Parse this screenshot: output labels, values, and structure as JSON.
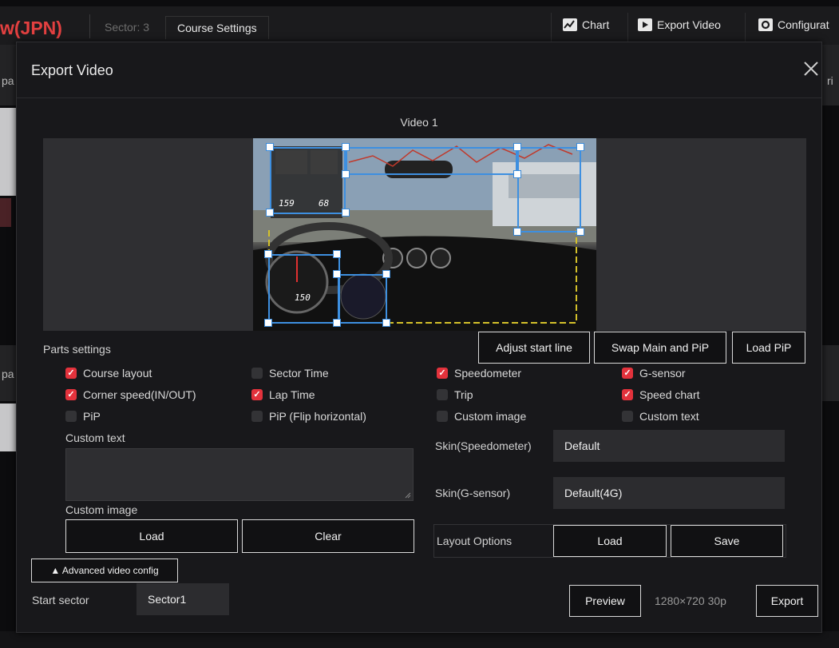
{
  "background": {
    "title": "w(JPN)",
    "sector": "Sector: 3",
    "course_settings": "Course Settings",
    "chart": "Chart",
    "export_video": "Export Video",
    "configuration": "Configurat",
    "edge_left_1": "pa",
    "edge_right_1": "ri",
    "edge_left_2": "pa"
  },
  "dialog": {
    "title": "Export Video",
    "video_label": "Video 1",
    "overlay_speed_1": "159",
    "overlay_speed_2": "68",
    "speedometer_value": "150",
    "adjust_start_line": "Adjust start line",
    "swap_main_pip": "Swap Main and PiP",
    "load_pip": "Load PiP",
    "parts_settings": "Parts settings",
    "parts": [
      {
        "label": "Course layout",
        "checked": true
      },
      {
        "label": "Sector Time",
        "checked": false
      },
      {
        "label": "Speedometer",
        "checked": true
      },
      {
        "label": "G-sensor",
        "checked": true
      },
      {
        "label": "Corner speed(IN/OUT)",
        "checked": true
      },
      {
        "label": "Lap Time",
        "checked": true
      },
      {
        "label": "Trip",
        "checked": false
      },
      {
        "label": "Speed chart",
        "checked": true
      },
      {
        "label": "PiP",
        "checked": false
      },
      {
        "label": "PiP (Flip horizontal)",
        "checked": false
      },
      {
        "label": "Custom image",
        "checked": false
      },
      {
        "label": "Custom text",
        "checked": false
      }
    ],
    "custom_text_label": "Custom text",
    "custom_text_value": "",
    "custom_image_label": "Custom image",
    "load": "Load",
    "clear": "Clear",
    "skin_speedometer_label": "Skin(Speedometer)",
    "skin_speedometer_value": "Default",
    "skin_gsensor_label": "Skin(G-sensor)",
    "skin_gsensor_value": "Default(4G)",
    "layout_options": "Layout Options",
    "layout_load": "Load",
    "layout_save": "Save",
    "advanced": "▲ Advanced video config",
    "start_sector_label": "Start sector",
    "start_sector_value": "Sector1",
    "preview": "Preview",
    "resolution": "1280×720 30p",
    "export": "Export"
  },
  "colors": {
    "accent_red": "#e3323c",
    "selection_blue": "#3d8fe0",
    "title_red": "#e34040"
  }
}
